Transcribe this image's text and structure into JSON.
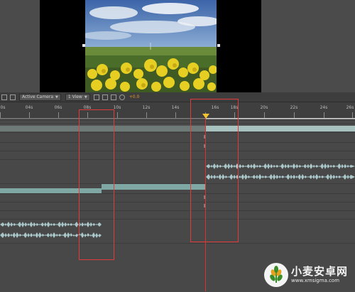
{
  "toolbar": {
    "camera_select": "Active Camera",
    "view_select": "1 View",
    "exposure_value": "+0.0",
    "icons": [
      "grid-icon",
      "resolution-icon",
      "region-icon",
      "fast-preview-icon",
      "reset-exposure-icon"
    ]
  },
  "ruler": {
    "ticks": [
      {
        "label": "0s"
      },
      {
        "label": "04s"
      },
      {
        "label": "06s"
      },
      {
        "label": "08s"
      },
      {
        "label": "10s"
      },
      {
        "label": "12s"
      },
      {
        "label": "14s"
      },
      {
        "label": "16s"
      },
      {
        "label": "18s"
      },
      {
        "label": "20s"
      },
      {
        "label": "22s"
      },
      {
        "label": "24s"
      },
      {
        "label": "26s"
      }
    ]
  },
  "timeline": {
    "playhead_time": "16s",
    "marker_glyph": "I"
  },
  "colors": {
    "layer_bar": "#9fc4c0",
    "layer_bar_dark": "#7fa8a4",
    "waveform": "#a9c6c8",
    "playhead": "#e03030",
    "current_time_marker": "#f2c230",
    "highlight_box": "#e23b3b"
  },
  "watermark": {
    "title": "小麦安卓网",
    "url": "www.xmsigma.com"
  }
}
